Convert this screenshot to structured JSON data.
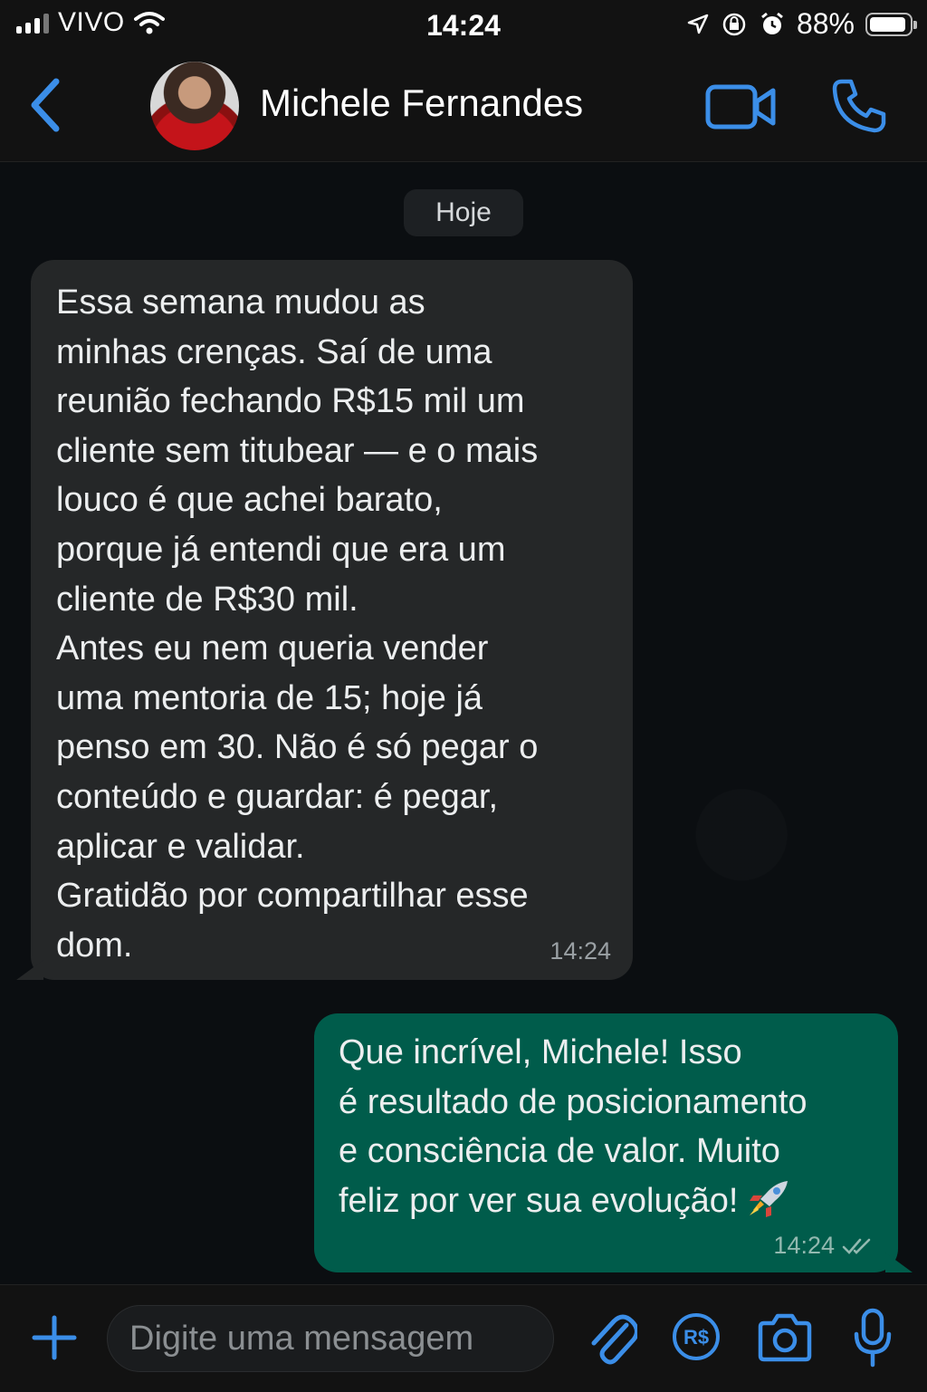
{
  "status_bar": {
    "carrier": "VIVO",
    "time": "14:24",
    "battery": "88%",
    "battery_level": 0.88,
    "icons": [
      "signal-icon",
      "wifi-icon",
      "location-icon",
      "rotation-lock-icon",
      "alarm-icon",
      "battery-icon"
    ]
  },
  "header": {
    "contact_name": "Michele Fernandes",
    "icons": [
      "back-chevron-icon",
      "avatar",
      "video-call-icon",
      "phone-icon"
    ]
  },
  "chat": {
    "date_chip": "Hoje",
    "incoming": {
      "text": "Essa semana mudou as\nminhas crenças. Saí de uma\nreunião fechando R$15 mil um\ncliente sem titubear — e o mais\nlouco é que achei barato,\nporque já entendi que era um\ncliente de R$30 mil.\nAntes eu nem queria vender\numa mentoria de 15; hoje já\npenso em 30. Não é só pegar o\nconteúdo e guardar: é pegar,\naplicar e validar.\nGratidão por compartilhar esse\ndom.",
      "time": "14:24"
    },
    "outgoing": {
      "text": "Que incrível, Michele! Isso\né resultado de posicionamento\ne consciência de valor. Muito\nfeliz por ver sua evolução! ",
      "emoji": "rocket-icon",
      "time": "14:24",
      "status": "read-double-check-icon"
    }
  },
  "input_bar": {
    "placeholder": "Digite uma mensagem",
    "pay_label": "R$",
    "icons": [
      "plus-icon",
      "paperclip-icon",
      "payment-icon",
      "camera-icon",
      "microphone-icon"
    ]
  },
  "colors": {
    "accent": "#3b8ee8",
    "incoming_bubble": "#252728",
    "outgoing_bubble": "#005c4b",
    "background": "#0b0e11"
  }
}
